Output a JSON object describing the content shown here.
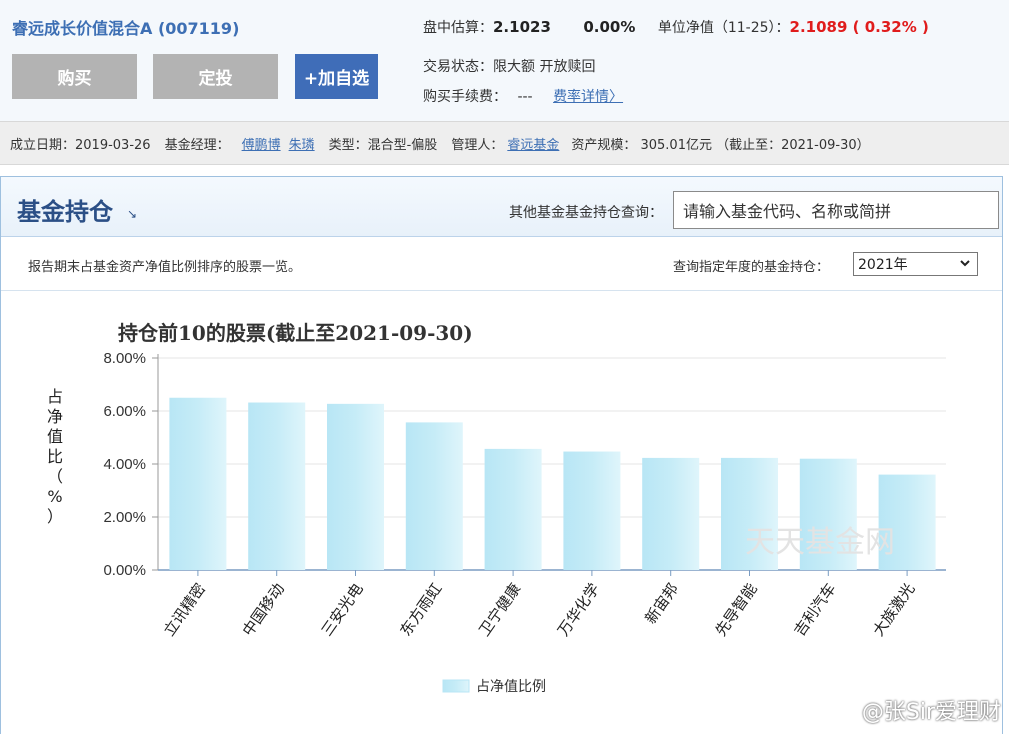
{
  "fund": {
    "title": "睿远成长价值混合A (007119)",
    "buttons": {
      "buy": "购买",
      "invest": "定投",
      "watch": "+加自选"
    },
    "estimate_label": "盘中估算：",
    "estimate_value": "2.1023",
    "estimate_change": "0.00%",
    "nav_label": "单位净值（11-25）：",
    "nav_value": "2.1089 ( 0.32% )",
    "status": "交易状态：限大额   开放赎回",
    "fee_label": "购买手续费：",
    "fee_value": "---",
    "fee_link": "费率详情〉"
  },
  "meta": {
    "established": "成立日期：2019-03-26",
    "manager_label": "基金经理：",
    "manager_1": "傅鹏博",
    "manager_2": "朱璘",
    "type": "类型：混合型-偏股",
    "custodian_label": "管理人：",
    "custodian": "睿远基金",
    "size": "资产规模：  305.01亿元  （截止至：2021-09-30）"
  },
  "holdings": {
    "title": "基金持仓",
    "title_arrow": "↘",
    "query_label": "其他基金基金持仓查询：",
    "query_placeholder": "请输入基金代码、名称或简拼",
    "desc": "报告期末占基金资产净值比例排序的股票一览。",
    "year_label": "查询指定年度的基金持仓：",
    "year_selected": "2021年",
    "chevron_icon": "chevron-down-icon"
  },
  "chart_data": {
    "type": "bar",
    "title": "持仓前10的股票(截止至2021-09-30)",
    "ylabel": "占净值比（%）",
    "categories": [
      "立讯精密",
      "中国移动",
      "三安光电",
      "东方雨虹",
      "卫宁健康",
      "万华化学",
      "新宙邦",
      "先导智能",
      "吉利汽车",
      "大族激光"
    ],
    "series": [
      {
        "name": "占净值比例",
        "values": [
          6.5,
          6.32,
          6.27,
          5.57,
          4.57,
          4.47,
          4.23,
          4.23,
          4.2,
          3.6
        ]
      }
    ],
    "ylim": [
      0,
      8
    ],
    "yticks": [
      "0.00%",
      "2.00%",
      "4.00%",
      "6.00%",
      "8.00%"
    ],
    "legend": "bottom-center",
    "grid": true,
    "bar_color": "#c6ecf7",
    "watermark": "天天基金网"
  },
  "weibo_mark": "@张Sir爱理财"
}
